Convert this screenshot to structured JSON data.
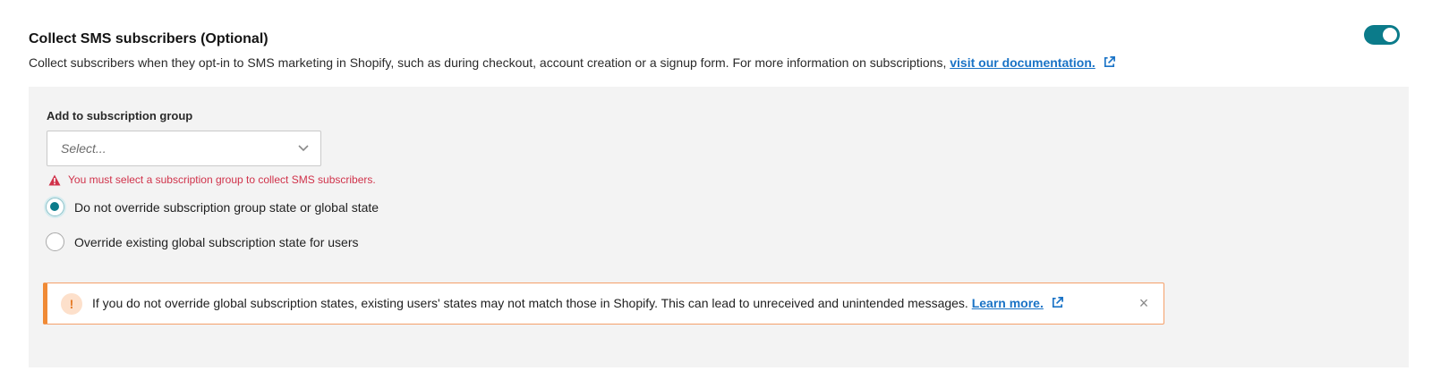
{
  "section": {
    "title": "Collect SMS subscribers (Optional)",
    "description": "Collect subscribers when they opt-in to SMS marketing in Shopify, such as during checkout, account creation or a signup form. For more information on subscriptions,",
    "doc_link": "visit our documentation.",
    "toggle_on": true
  },
  "colors": {
    "accent": "#0b7b8a",
    "link": "#1a73c6",
    "error": "#d0324a",
    "warning": "#f08a35",
    "panel_bg": "#f3f3f3"
  },
  "subscription_group": {
    "label": "Add to subscription group",
    "placeholder": "Select...",
    "error": "You must select a subscription group to collect SMS subscribers."
  },
  "radios": [
    {
      "label": "Do not override subscription group state or global state",
      "checked": true
    },
    {
      "label": "Override existing global subscription state for users",
      "checked": false
    }
  ],
  "alert": {
    "icon": "!",
    "message": "If you do not override global subscription states, existing users' states may not match those in Shopify. This can lead to unreceived and unintended messages.",
    "link": "Learn more.",
    "close": "×"
  }
}
